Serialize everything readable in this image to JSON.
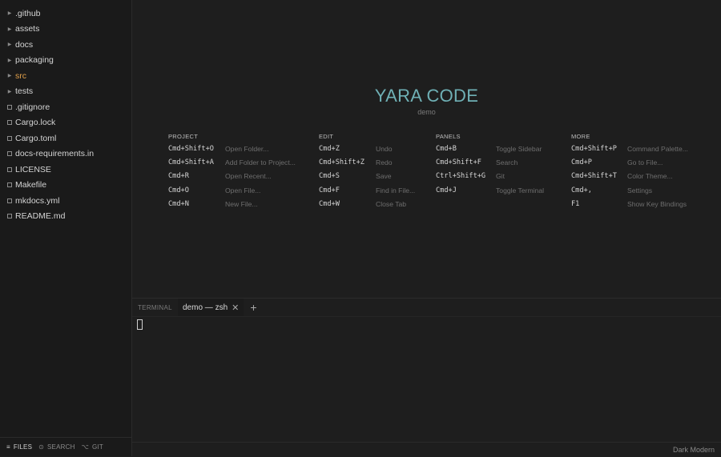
{
  "sidebar": {
    "items": [
      {
        "label": ".github",
        "type": "folder",
        "active": false
      },
      {
        "label": "assets",
        "type": "folder",
        "active": false
      },
      {
        "label": "docs",
        "type": "folder",
        "active": false
      },
      {
        "label": "packaging",
        "type": "folder",
        "active": false
      },
      {
        "label": "src",
        "type": "folder",
        "active": true
      },
      {
        "label": "tests",
        "type": "folder",
        "active": false
      },
      {
        "label": ".gitignore",
        "type": "file",
        "active": false
      },
      {
        "label": "Cargo.lock",
        "type": "file",
        "active": false
      },
      {
        "label": "Cargo.toml",
        "type": "file",
        "active": false
      },
      {
        "label": "docs-requirements.in",
        "type": "file",
        "active": false
      },
      {
        "label": "LICENSE",
        "type": "file",
        "active": false
      },
      {
        "label": "Makefile",
        "type": "file",
        "active": false
      },
      {
        "label": "mkdocs.yml",
        "type": "file",
        "active": false
      },
      {
        "label": "README.md",
        "type": "file",
        "active": false
      }
    ],
    "footer_tabs": [
      {
        "label": "FILES",
        "icon": "list-icon",
        "glyph": "≡",
        "active": true
      },
      {
        "label": "SEARCH",
        "icon": "search-icon",
        "glyph": "⊙",
        "active": false
      },
      {
        "label": "GIT",
        "icon": "git-branch-icon",
        "glyph": "⌥",
        "active": false
      }
    ]
  },
  "welcome": {
    "title": "YARA CODE",
    "subtitle": "demo",
    "accent_color": "#6fb0b5",
    "groups": [
      {
        "heading": "PROJECT",
        "items": [
          {
            "key": "Cmd+Shift+O",
            "action": "Open Folder..."
          },
          {
            "key": "Cmd+Shift+A",
            "action": "Add Folder to Project..."
          },
          {
            "key": "Cmd+R",
            "action": "Open Recent..."
          },
          {
            "key": "Cmd+O",
            "action": "Open File..."
          },
          {
            "key": "Cmd+N",
            "action": "New File..."
          }
        ]
      },
      {
        "heading": "EDIT",
        "items": [
          {
            "key": "Cmd+Z",
            "action": "Undo"
          },
          {
            "key": "Cmd+Shift+Z",
            "action": "Redo"
          },
          {
            "key": "Cmd+S",
            "action": "Save"
          },
          {
            "key": "Cmd+F",
            "action": "Find in File..."
          },
          {
            "key": "Cmd+W",
            "action": "Close Tab"
          }
        ]
      },
      {
        "heading": "PANELS",
        "items": [
          {
            "key": "Cmd+B",
            "action": "Toggle Sidebar"
          },
          {
            "key": "Cmd+Shift+F",
            "action": "Search"
          },
          {
            "key": "Ctrl+Shift+G",
            "action": "Git"
          },
          {
            "key": "Cmd+J",
            "action": "Toggle Terminal"
          }
        ]
      },
      {
        "heading": "MORE",
        "items": [
          {
            "key": "Cmd+Shift+P",
            "action": "Command Palette..."
          },
          {
            "key": "Cmd+P",
            "action": "Go to File..."
          },
          {
            "key": "Cmd+Shift+T",
            "action": "Color Theme..."
          },
          {
            "key": "Cmd+,",
            "action": "Settings"
          },
          {
            "key": "F1",
            "action": "Show Key Bindings"
          }
        ]
      }
    ]
  },
  "terminal": {
    "label": "TERMINAL",
    "tabs": [
      {
        "title": "demo — zsh",
        "active": true
      }
    ],
    "add_label": "+"
  },
  "status": {
    "theme": "Dark Modern"
  }
}
